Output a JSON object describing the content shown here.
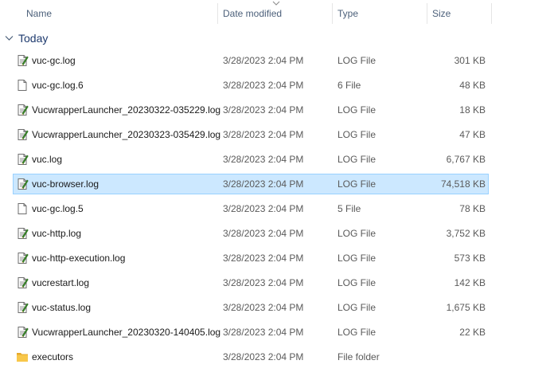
{
  "columns": {
    "name": "Name",
    "date_modified": "Date modified",
    "type": "Type",
    "size": "Size"
  },
  "group": {
    "label": "Today"
  },
  "files": [
    {
      "name": "vuc-gc.log",
      "date": "3/28/2023 2:04 PM",
      "type": "LOG File",
      "size": "301 KB",
      "icon": "log-file-icon"
    },
    {
      "name": "vuc-gc.log.6",
      "date": "3/28/2023 2:04 PM",
      "type": "6 File",
      "size": "48 KB",
      "icon": "blank-file-icon"
    },
    {
      "name": "VucwrapperLauncher_20230322-035229.log",
      "date": "3/28/2023 2:04 PM",
      "type": "LOG File",
      "size": "18 KB",
      "icon": "log-file-icon"
    },
    {
      "name": "VucwrapperLauncher_20230323-035429.log",
      "date": "3/28/2023 2:04 PM",
      "type": "LOG File",
      "size": "47 KB",
      "icon": "log-file-icon"
    },
    {
      "name": "vuc.log",
      "date": "3/28/2023 2:04 PM",
      "type": "LOG File",
      "size": "6,767 KB",
      "icon": "log-file-icon"
    },
    {
      "name": "vuc-browser.log",
      "date": "3/28/2023 2:04 PM",
      "type": "LOG File",
      "size": "74,518 KB",
      "icon": "log-file-icon",
      "selected": true
    },
    {
      "name": "vuc-gc.log.5",
      "date": "3/28/2023 2:04 PM",
      "type": "5 File",
      "size": "78 KB",
      "icon": "blank-file-icon"
    },
    {
      "name": "vuc-http.log",
      "date": "3/28/2023 2:04 PM",
      "type": "LOG File",
      "size": "3,752 KB",
      "icon": "log-file-icon"
    },
    {
      "name": "vuc-http-execution.log",
      "date": "3/28/2023 2:04 PM",
      "type": "LOG File",
      "size": "573 KB",
      "icon": "log-file-icon"
    },
    {
      "name": "vucrestart.log",
      "date": "3/28/2023 2:04 PM",
      "type": "LOG File",
      "size": "142 KB",
      "icon": "log-file-icon"
    },
    {
      "name": "vuc-status.log",
      "date": "3/28/2023 2:04 PM",
      "type": "LOG File",
      "size": "1,675 KB",
      "icon": "log-file-icon"
    },
    {
      "name": "VucwrapperLauncher_20230320-140405.log",
      "date": "3/28/2023 2:04 PM",
      "type": "LOG File",
      "size": "22 KB",
      "icon": "log-file-icon"
    },
    {
      "name": "executors",
      "date": "3/28/2023 2:04 PM",
      "type": "File folder",
      "size": "",
      "icon": "folder-icon"
    }
  ],
  "colors": {
    "selection_bg": "#cce8ff",
    "selection_border": "#99d1ff",
    "header_text": "#4c607a",
    "group_text": "#1e3a6e",
    "folder": "#f8c74a"
  }
}
